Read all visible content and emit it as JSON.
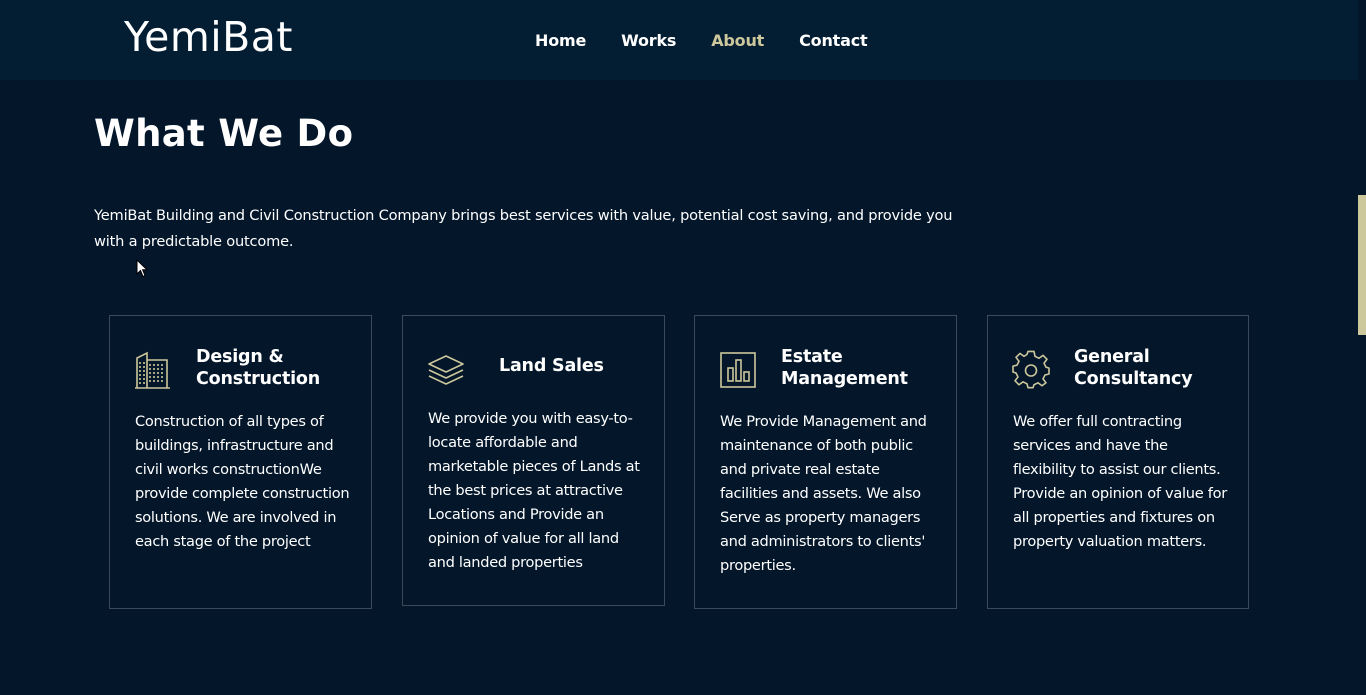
{
  "header": {
    "brand": "YemiBat",
    "nav": [
      {
        "label": "Home",
        "active": false
      },
      {
        "label": "Works",
        "active": false
      },
      {
        "label": "About",
        "active": true
      },
      {
        "label": "Contact",
        "active": false
      }
    ]
  },
  "main": {
    "title": "What We Do",
    "intro": "YemiBat Building and Civil Construction Company brings best services with value, potential cost saving, and provide you with a predictable outcome.",
    "services": [
      {
        "icon": "building-icon",
        "title": "Design & Construction",
        "description": "Construction of all types of buildings, infrastructure and civil works constructionWe provide complete construction solutions. We are involved in each stage of the project"
      },
      {
        "icon": "layers-icon",
        "title": "Land Sales",
        "description": "We provide you with easy-to-locate affordable and marketable pieces of Lands at the best prices at attractive Locations and Provide an opinion of value for all land and landed properties"
      },
      {
        "icon": "bar-chart-icon",
        "title": "Estate Management",
        "description": "We Provide Management and maintenance of both public and private real estate facilities and assets. We also Serve as property managers and administrators to clients' properties."
      },
      {
        "icon": "gear-icon",
        "title": "General Consultancy",
        "description": "We offer full contracting services and have the flexibility to assist our clients. Provide an opinion of value for all properties and fixtures on property valuation matters."
      }
    ]
  },
  "colors": {
    "background": "#03162a",
    "header": "#031d33",
    "accent": "#cdc79c",
    "card_border": "#3a4a5a",
    "text": "#ffffff"
  }
}
